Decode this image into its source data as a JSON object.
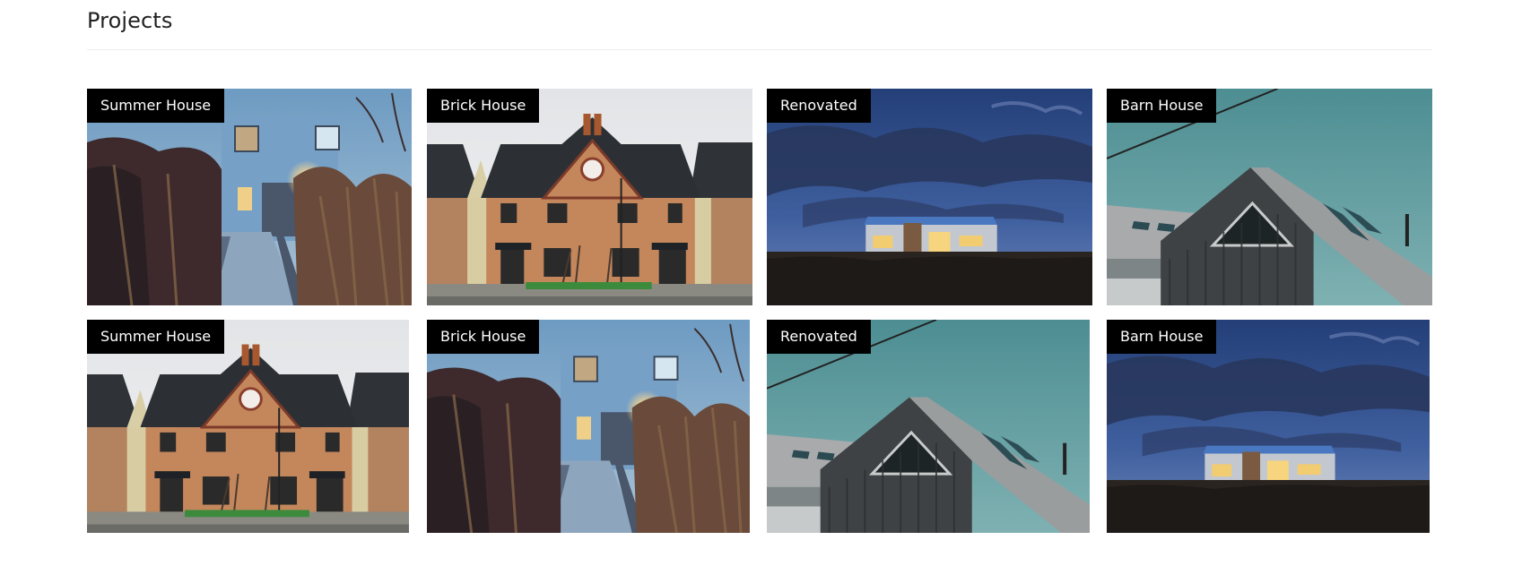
{
  "section": {
    "title": "Projects"
  },
  "projects": [
    {
      "label": "Summer House",
      "photo": "summer-house-photo"
    },
    {
      "label": "Brick House",
      "photo": "brick-house-photo"
    },
    {
      "label": "Renovated",
      "photo": "night-house-photo"
    },
    {
      "label": "Barn House",
      "photo": "barn-house-photo"
    },
    {
      "label": "Summer House",
      "photo": "brick-house-photo"
    },
    {
      "label": "Brick House",
      "photo": "summer-house-photo"
    },
    {
      "label": "Renovated",
      "photo": "barn-house-photo"
    },
    {
      "label": "Barn House",
      "photo": "night-house-photo"
    }
  ]
}
